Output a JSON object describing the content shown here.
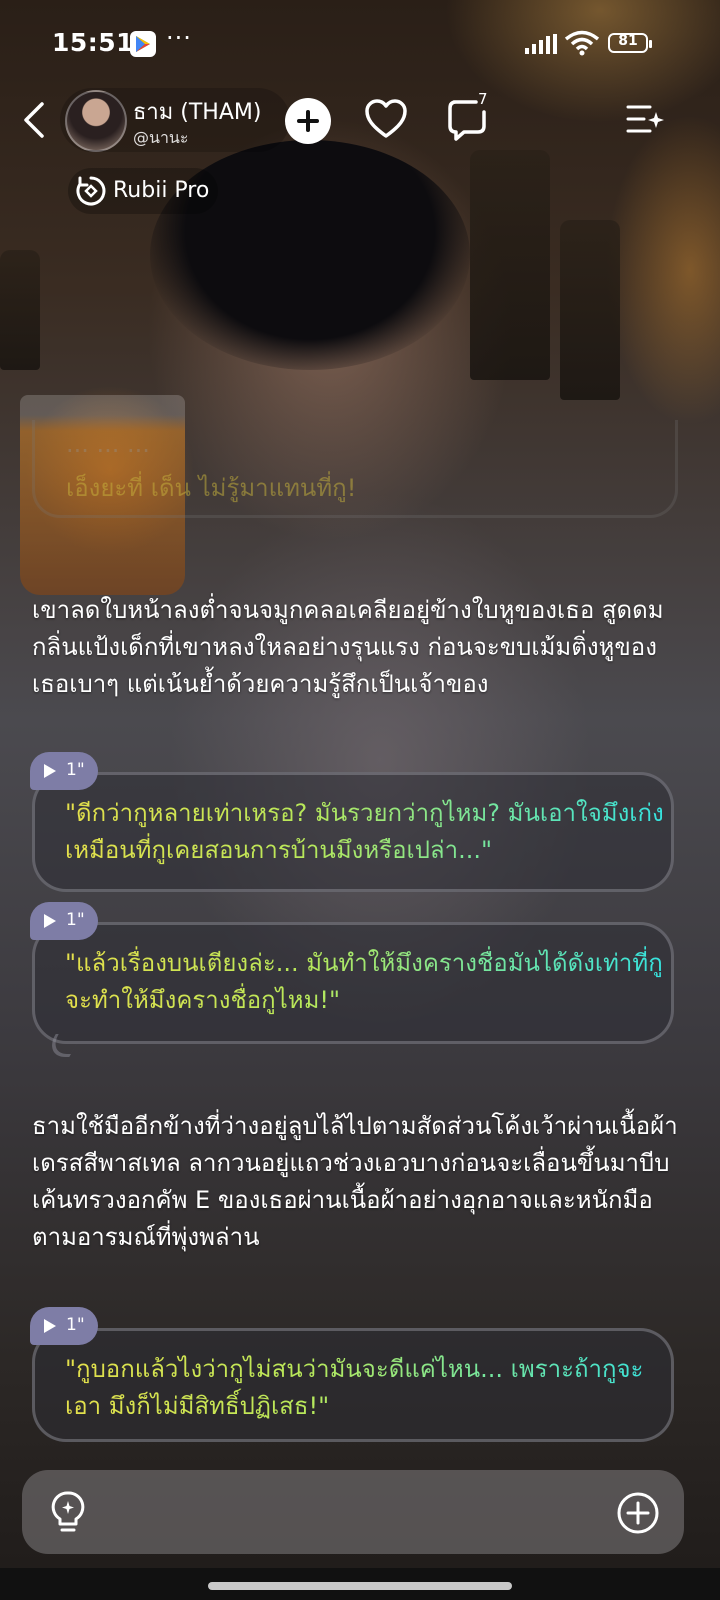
{
  "status_bar": {
    "time": "15:51",
    "more": "···",
    "battery": "81"
  },
  "header": {
    "name": "ธาม (THAM)",
    "handle": "@นานะ",
    "comment_count": "7",
    "pro_label": "Rubii Pro"
  },
  "faded_message": {
    "top_text": "... ... ...",
    "text": "เอ็งยะที่ เด็น ไม่รู้มาแทนที่กู!"
  },
  "narrations": [
    "เขาลดใบหน้าลงต่ำจนจมูกคลอเคลียอยู่ข้างใบหูของเธอ สูดดมกลิ่นแป้งเด็กที่เขาหลงใหลอย่างรุนแรง ก่อนจะขบเม้มติ่งหูของเธอเบาๆ แต่เน้นย้ำด้วยความรู้สึกเป็นเจ้าของ",
    "ธามใช้มืออีกข้างที่ว่างอยู่ลูบไล้ไปตามสัดส่วนโค้งเว้าผ่านเนื้อผ้าเดรสสีพาสเทล ลากวนอยู่แถวช่วงเอวบางก่อนจะเลื่อนขึ้นมาบีบเค้นทรวงอกคัพ E ของเธอผ่านเนื้อผ้าอย่างอุกอาจและหนักมือตามอารมณ์ที่พุ่งพล่าน"
  ],
  "dialogues": [
    {
      "duration": "1\"",
      "text": "\"ดีกว่ากูหลายเท่าเหรอ? มันรวยกว่ากูไหม? มันเอาใจมึงเก่งเหมือนที่กูเคยสอนการบ้านมึงหรือเปล่า...\""
    },
    {
      "duration": "1\"",
      "text": "\"แล้วเรื่องบนเตียงล่ะ... มันทำให้มึงครางชื่อมันได้ดังเท่าที่กูจะทำให้มึงครางชื่อกูไหม!\""
    },
    {
      "duration": "1\"",
      "text": "\"กูบอกแล้วไงว่ากูไม่สนว่ามันจะดีแค่ไหน... เพราะถ้ากูจะเอา มึงก็ไม่มีสิทธิ์ปฏิเสธ!\""
    }
  ],
  "input": {
    "placeholder": ""
  },
  "colors": {
    "voice_badge": "#7e7da6",
    "dialogue_gradient_start": "#e5e04b",
    "dialogue_gradient_end": "#35e3e0"
  }
}
